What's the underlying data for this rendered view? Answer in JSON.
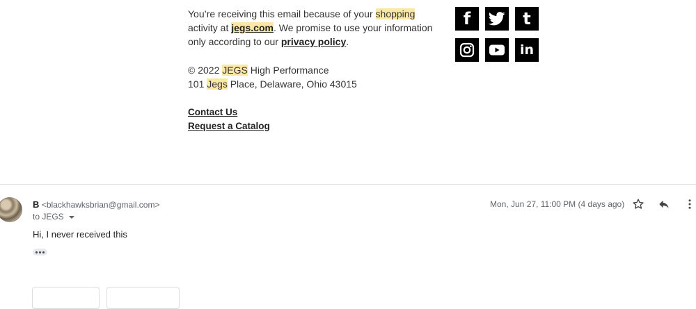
{
  "footer": {
    "line1_pre": "You’re receiving this email because of your ",
    "line1_hl": "shopping",
    "line2_pre": "activity at ",
    "site_link": "jegs.com",
    "line2_post": ". We promise to use your information",
    "line3_pre": "only according to our ",
    "privacy_link": "privacy policy",
    "line3_post": ".",
    "copyright_pre": "© 2022 ",
    "copyright_hl": "JEGS",
    "copyright_post": " High Performance",
    "address_pre": "101 ",
    "address_hl": "Jegs",
    "address_post": " Place, Delaware, Ohio 43015",
    "contact_link": "Contact Us",
    "catalog_link": "Request a Catalog"
  },
  "social": [
    {
      "name": "facebook-icon",
      "glyph": "f"
    },
    {
      "name": "twitter-icon",
      "glyph": ""
    },
    {
      "name": "tumblr-icon",
      "glyph": "t"
    },
    {
      "name": "instagram-icon",
      "glyph": ""
    },
    {
      "name": "youtube-icon",
      "glyph": ""
    },
    {
      "name": "linkedin-icon",
      "glyph": "in"
    }
  ],
  "message": {
    "sender_name": "B",
    "sender_email": "<blackhawksbrian@gmail.com>",
    "to_line": "to JEGS",
    "date": "Mon, Jun 27, 11:00 PM (4 days ago)",
    "body": "Hi, I never received this"
  }
}
